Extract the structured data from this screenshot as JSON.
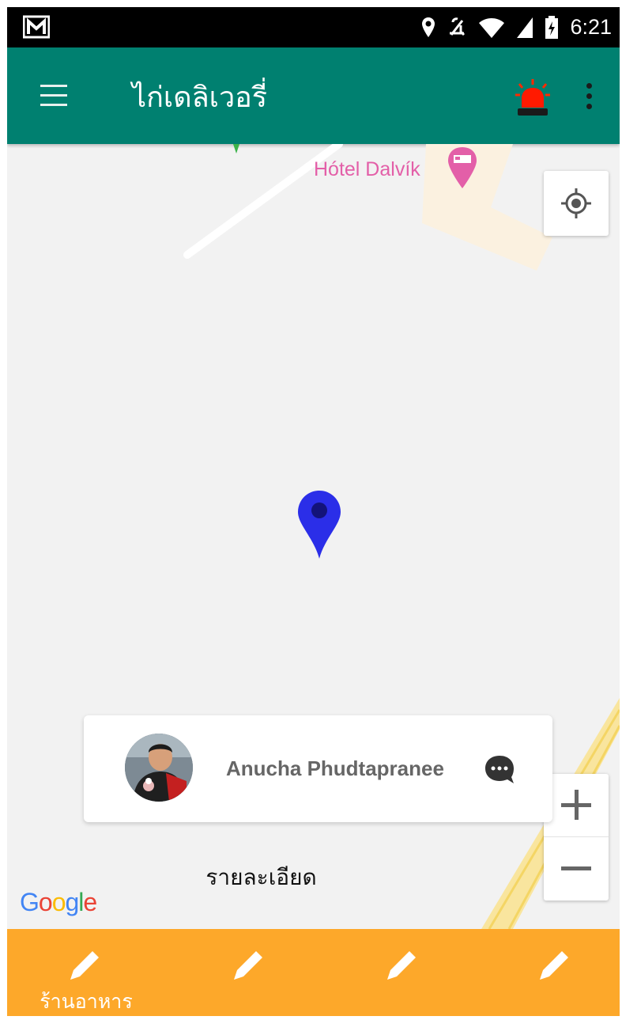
{
  "status_bar": {
    "time": "6:21",
    "icons": [
      "gmail-icon",
      "location-icon",
      "mute-icon",
      "wifi-icon",
      "signal-icon",
      "battery-icon"
    ]
  },
  "toolbar": {
    "title": "ไก่เดลิเวอรี่",
    "menu_icon": "hamburger-menu-icon",
    "alarm_icon": "siren-icon",
    "overflow_icon": "more-vertical-icon",
    "color": "#008070"
  },
  "map": {
    "poi_label": "Hótel Dalvík",
    "poi_icon": "hotel-icon",
    "logo": "Google",
    "zoom_in_icon": "plus-icon",
    "zoom_out_icon": "minus-icon",
    "locate_icon": "my-location-icon",
    "marker_color": "#2b2ee8"
  },
  "driver": {
    "name": "Anucha Phudtapranee",
    "chat_icon": "chat-bubble-icon"
  },
  "details_link": "รายละเอียด",
  "bottom_nav": {
    "color": "#fda82a",
    "items": [
      {
        "label": "ร้านอาหาร",
        "icon": "pencil-icon"
      },
      {
        "label": "",
        "icon": "pencil-icon"
      },
      {
        "label": "",
        "icon": "pencil-icon"
      },
      {
        "label": "",
        "icon": "pencil-icon"
      }
    ]
  }
}
